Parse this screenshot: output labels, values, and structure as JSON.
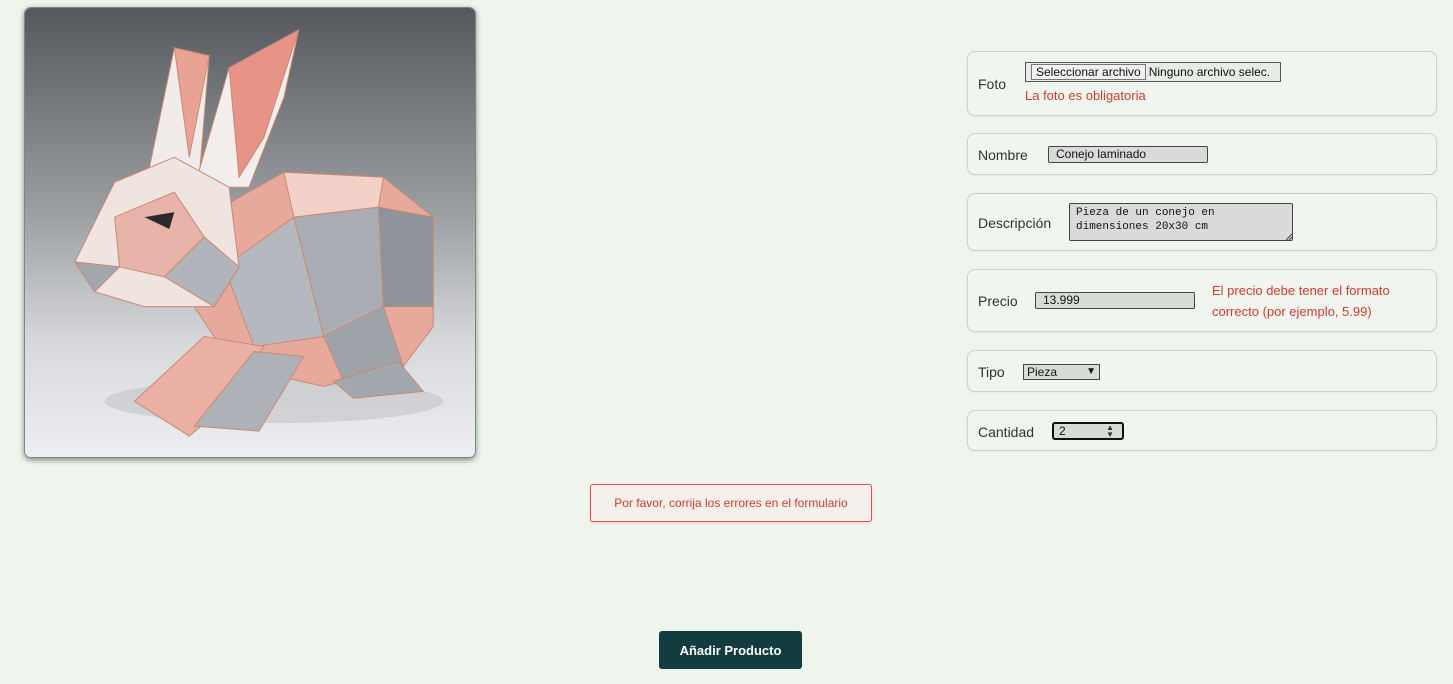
{
  "image": {
    "alt": "Conejo laminado"
  },
  "form": {
    "foto": {
      "label": "Foto",
      "button_label": "Seleccionar archivo",
      "file_name": "Ninguno archivo selec.",
      "error": "La foto es obligatoria"
    },
    "nombre": {
      "label": "Nombre",
      "value": "Conejo laminado"
    },
    "descripcion": {
      "label": "Descripción",
      "value": "Pieza de un conejo en\ndimensiones 20x30 cm"
    },
    "precio": {
      "label": "Precio",
      "value": "13.999",
      "error_line1": "El precio debe tener el formato",
      "error_line2": "correcto (por ejemplo, 5.99)"
    },
    "tipo": {
      "label": "Tipo",
      "value": "Pieza"
    },
    "cantidad": {
      "label": "Cantidad",
      "value": "2"
    }
  },
  "alert": {
    "message": "Por favor, corrija los errores en el formulario"
  },
  "submit": {
    "label": "Añadir Producto"
  },
  "colors": {
    "background": "#eff5ec",
    "error": "#d13b2c",
    "primary": "#123c3e"
  }
}
